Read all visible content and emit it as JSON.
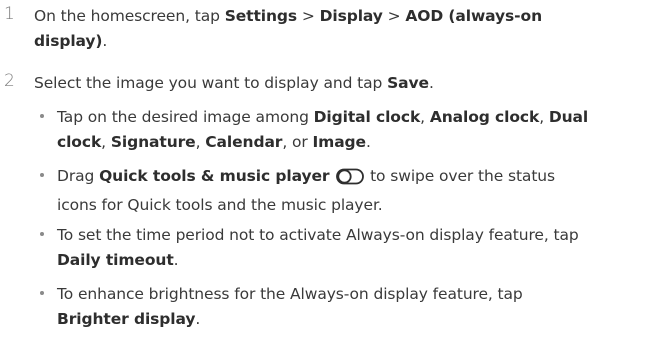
{
  "steps": [
    {
      "number": "1",
      "parts": [
        "On the homescreen, tap ",
        "Settings",
        " > ",
        "Display",
        " > ",
        "AOD (always-on",
        "display)",
        "."
      ]
    },
    {
      "number": "2",
      "parts": [
        "Select the image you want to display and tap ",
        "Save",
        "."
      ]
    }
  ],
  "bullets": [
    {
      "parts": [
        "Tap on the desired image among ",
        "Digital clock",
        ", ",
        "Analog clock",
        ", ",
        "Dual",
        "clock",
        ", ",
        "Signature",
        ", ",
        "Calendar",
        ", or ",
        "Image",
        "."
      ]
    },
    {
      "parts": [
        "Drag ",
        "Quick tools & music player",
        " to swipe over the status",
        "icons for Quick tools and the music player."
      ],
      "icon": "toggle-switch-icon"
    },
    {
      "parts": [
        "To set the time period not to activate Always-on display feature, tap",
        "Daily timeout",
        "."
      ]
    },
    {
      "parts": [
        "To enhance brightness for the Always-on display feature, tap",
        "Brighter display",
        "."
      ]
    }
  ]
}
